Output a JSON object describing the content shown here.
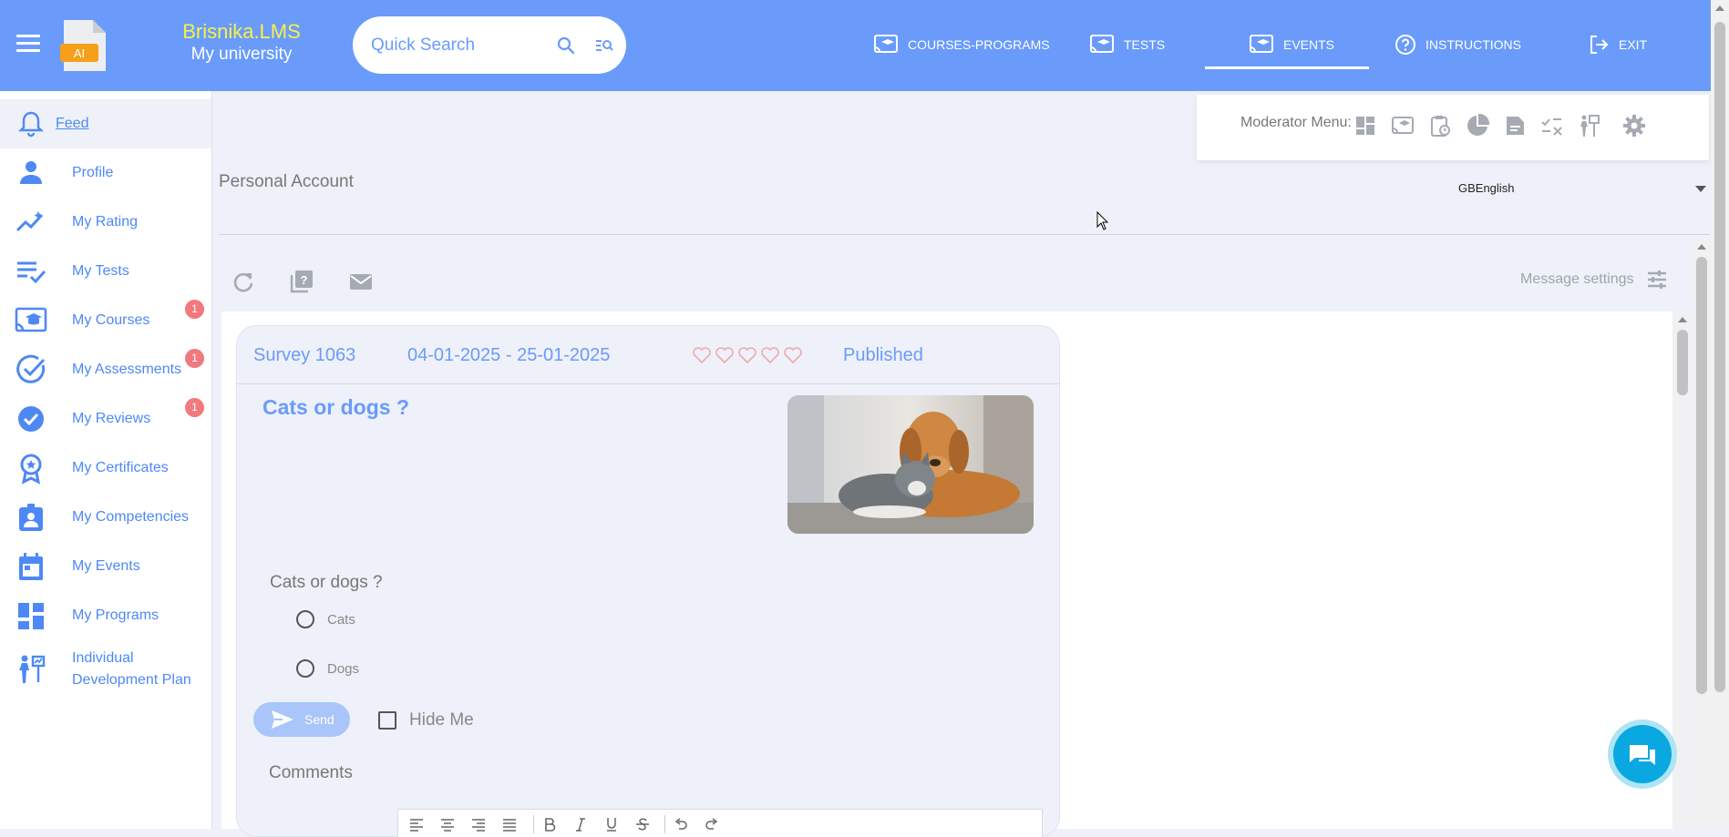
{
  "header": {
    "brand_line1": "Brisnika.LMS",
    "brand_line2": "My university",
    "logo_badge": "AI",
    "search_placeholder": "Quick Search",
    "nav": [
      {
        "label": "COURSES-PROGRAMS",
        "icon": "cast-education-icon"
      },
      {
        "label": "TESTS",
        "icon": "cast-education-icon"
      },
      {
        "label": "EVENTS",
        "icon": "cast-education-icon",
        "active": true
      },
      {
        "label": "INSTRUCTIONS",
        "icon": "help-circle-icon"
      },
      {
        "label": "EXIT",
        "icon": "logout-icon"
      }
    ]
  },
  "sidebar": {
    "items": [
      {
        "label": "Feed",
        "icon": "bell-icon",
        "active": true
      },
      {
        "label": "Profile",
        "icon": "person-icon"
      },
      {
        "label": "My Rating",
        "icon": "trending-icon"
      },
      {
        "label": "My Tests",
        "icon": "checklist-icon"
      },
      {
        "label": "My Courses",
        "icon": "cast-education-icon",
        "badge": "1"
      },
      {
        "label": "My Assessments",
        "icon": "check-circle-icon",
        "badge": "1"
      },
      {
        "label": "My Reviews",
        "icon": "rate-review-icon",
        "badge": "1"
      },
      {
        "label": "My Certificates",
        "icon": "award-icon"
      },
      {
        "label": "My Competencies",
        "icon": "badge-icon"
      },
      {
        "label": "My Events",
        "icon": "calendar-icon"
      },
      {
        "label": "My Programs",
        "icon": "dashboard-icon"
      },
      {
        "label": "Individual Development Plan",
        "icon": "growth-plan-icon"
      }
    ]
  },
  "moderator": {
    "label": "Moderator Menu:"
  },
  "page": {
    "title": "Personal Account",
    "language": "GBEnglish",
    "message_settings": "Message settings"
  },
  "survey": {
    "name": "Survey 1063",
    "date_range": "04-01-2025 - 25-01-2025",
    "rating": 0,
    "rating_max": 5,
    "status": "Published",
    "title": "Cats or dogs ?",
    "question": "Cats or dogs ?",
    "options": [
      "Cats",
      "Dogs"
    ],
    "send_label": "Send",
    "hide_me_label": "Hide Me",
    "comments_label": "Comments"
  },
  "colors": {
    "accent": "#6a9bfa",
    "sidebar_text": "#4e88f5",
    "badge": "#f2797d",
    "chat": "#0aa8e0"
  }
}
